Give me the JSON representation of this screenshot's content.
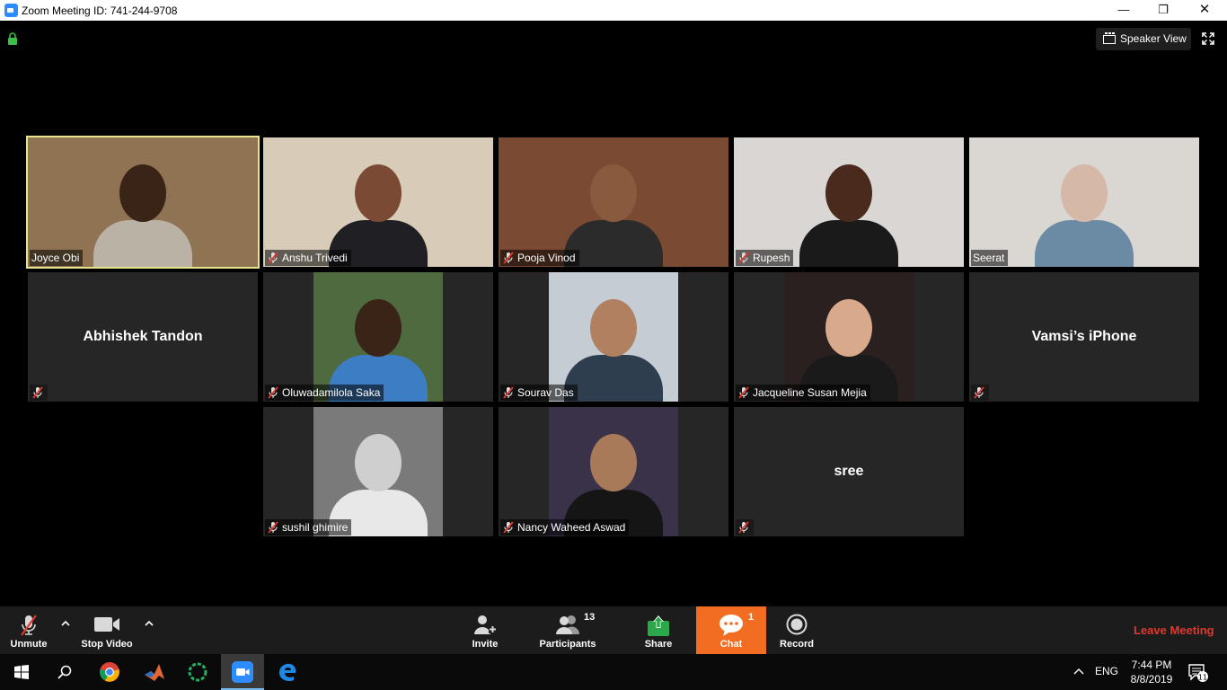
{
  "window": {
    "title": "Zoom Meeting ID: 741-244-9708",
    "min_glyph": "—",
    "max_glyph": "❐",
    "close_glyph": "✕"
  },
  "top": {
    "speaker_view_label": "Speaker View"
  },
  "participants": [
    {
      "name": "Joyce Obi",
      "video": true,
      "muted": false,
      "active_speaker": true,
      "bg": "#8f7353",
      "skin": "#3a2418",
      "shirt": "#b9b2a5"
    },
    {
      "name": "Anshu Trivedi",
      "video": true,
      "muted": true,
      "bg": "#d8ccb8",
      "skin": "#7a4a34",
      "shirt": "#1f1f24"
    },
    {
      "name": "Pooja Vinod",
      "video": true,
      "muted": true,
      "bg": "#7b4a32",
      "skin": "#8a5a3e",
      "shirt": "#2b2b2b"
    },
    {
      "name": "Rupesh",
      "video": true,
      "muted": true,
      "bg": "#d9d6d3",
      "skin": "#4a2a1c",
      "shirt": "#1a1a1a"
    },
    {
      "name": "Seerat",
      "video": true,
      "muted": false,
      "bg": "#dad7d3",
      "skin": "#d6b8a6",
      "shirt": "#6b8aa3"
    },
    {
      "name": "Abhishek Tandon",
      "video": false,
      "muted": true
    },
    {
      "name": "Oluwadamilola Saka",
      "video": true,
      "muted": true,
      "bg": "#4f6a3e",
      "skin": "#3a2418",
      "shirt": "#3c7dc4"
    },
    {
      "name": "Sourav Das",
      "video": true,
      "muted": true,
      "bg": "#c5ccd3",
      "skin": "#b08060",
      "shirt": "#2f3e4f"
    },
    {
      "name": "Jacqueline Susan Mejia",
      "video": true,
      "muted": true,
      "bg": "#2a2020",
      "skin": "#d9a98c",
      "shirt": "#1a1a1a"
    },
    {
      "name": "Vamsi’s iPhone",
      "video": false,
      "muted": true
    },
    {
      "name": "sushil ghimire",
      "video": true,
      "muted": true,
      "bg": "#7a7a7a",
      "skin": "#cfcfcf",
      "shirt": "#e8e8e8"
    },
    {
      "name": "Nancy Waheed Aswad",
      "video": true,
      "muted": true,
      "bg": "#3a3248",
      "skin": "#a87a5a",
      "shirt": "#151515"
    },
    {
      "name": "sree",
      "video": false,
      "muted": true
    }
  ],
  "toolbar": {
    "unmute_label": "Unmute",
    "stop_video_label": "Stop Video",
    "invite_label": "Invite",
    "participants_label": "Participants",
    "participants_count": "13",
    "share_label": "Share",
    "chat_label": "Chat",
    "chat_badge": "1",
    "record_label": "Record",
    "leave_label": "Leave Meeting",
    "colors": {
      "chat_active": "#f26d21",
      "share": "#2ba84a",
      "leave": "#e0382f"
    }
  },
  "taskbar": {
    "apps": [
      "windows-start-icon",
      "search-icon",
      "chrome-icon",
      "matlab-icon",
      "app-ring-icon",
      "zoom-icon",
      "edge-icon"
    ],
    "language": "ENG",
    "time": "7:44 PM",
    "date": "8/8/2019",
    "notification_count": "11"
  }
}
